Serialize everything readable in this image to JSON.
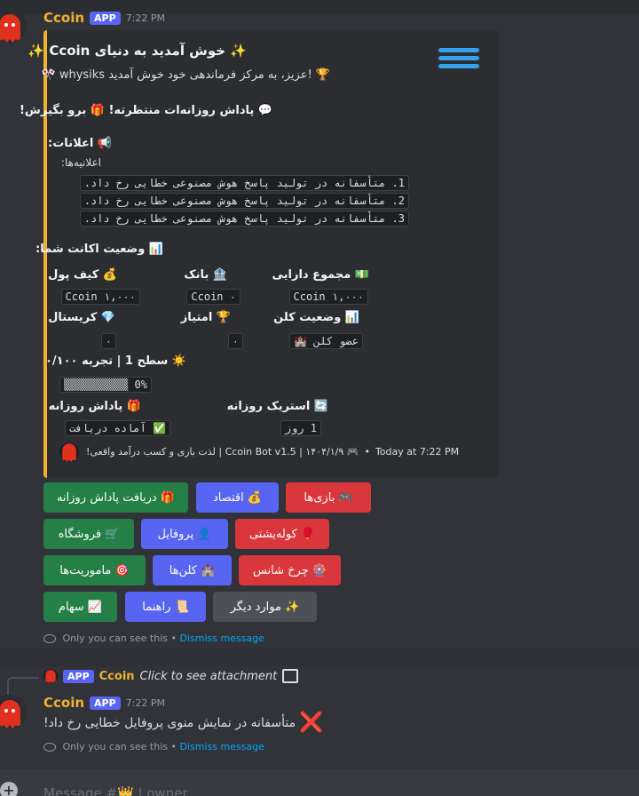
{
  "message1": {
    "username": "Ccoin",
    "badge": "APP",
    "time": "7:22 PM"
  },
  "embed": {
    "title": "✨ خوش آمدید به دنیای Ccoin ✨",
    "welcome_line": "🏆 !عزیز، به مرکز فرماندهی خود خوش آمدید whysiks 🎌",
    "daily_promo": "💬 پاداش روزانه‌ات منتظرته! 🎁 برو بگیرش!",
    "announcements_title": "📢 اعلانات:",
    "announcements_sub": "اعلانیه‌ها:",
    "announcements": [
      "1. متأسفانه در تولید پاسخ هوش مصنوعی خطایی رخ داد.",
      "2. متأسفانه در تولید پاسخ هوش مصنوعی خطایی رخ داد.",
      "3. متأسفانه در تولید پاسخ هوش مصنوعی خطایی رخ داد."
    ],
    "account_title": "📊 وضعیت اکانت شما:",
    "fields": {
      "total_label": "💵 مجموع دارایی",
      "total_value": "۱,۰۰۰ Ccoin",
      "bank_label": "🏦 بانک",
      "bank_value": "۰ Ccoin",
      "wallet_label": "💰 کیف پول",
      "wallet_value": "۱,۰۰۰ Ccoin",
      "clan_label": "📊 وضعیت کلن",
      "clan_value": "عضو کلن 🏰",
      "points_label": "🏆 امتیاز",
      "points_value": "۰",
      "crystal_label": "💎 کریستال",
      "crystal_value": "۰",
      "level_label": "☀️ سطح 1 | تجربه ۰/۱۰۰",
      "level_bar": "▒▒▒▒▒▒▒▒▒▒ 0%",
      "level_progress": 0,
      "streak_label": "🔄 استریک روزانه",
      "streak_value": "1 روز",
      "reward_label": "🎁 پاداش روزانه",
      "reward_value": "✅ آماده دریافت"
    },
    "footer": "🎮 Ccoin Bot v1.5 | ۱۴۰۴/۱/۹ | لذت بازی و کسب درآمد واقعی!",
    "footer_time": "Today at 7:22 PM"
  },
  "buttons": {
    "games": "🎮 بازی‌ها",
    "economy": "💰 اقتصاد",
    "daily": "🎁 دریافت پاداش روزانه",
    "colosseum": "🥊 کولەیشتی",
    "profile": "👤 پروفایل",
    "shop": "🛒 فروشگاه",
    "wheel": "🎡 چرخ شانس",
    "clans": "🏰 کلن‌ها",
    "missions": "🎯 ماموریت‌ها",
    "more": "✨ موارد دیگر",
    "guide": "📜 راهنما",
    "stocks": "📈 سهام"
  },
  "ephemeral": {
    "text": "Only you can see this •",
    "dismiss": "Dismiss message"
  },
  "reply": {
    "badge": "APP",
    "username": "Ccoin",
    "text": "Click to see attachment"
  },
  "message2": {
    "username": "Ccoin",
    "badge": "APP",
    "time": "7:22 PM",
    "content": "متأسفانه در نمایش منوی پروفایل خطایی رخ داد!",
    "error_icon": "❌"
  },
  "input": {
    "placeholder": "Message #👑 | owner"
  },
  "colors": {
    "embed_accent": "#f0b232",
    "green": "#248046",
    "blue": "#5865f2",
    "red": "#da373c",
    "grey": "#4e5058"
  }
}
